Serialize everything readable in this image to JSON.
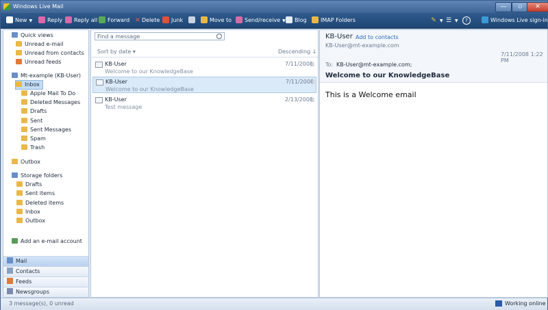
{
  "window": {
    "title": "Windows Live Mail",
    "min": "—",
    "max": "▫",
    "close": "✕"
  },
  "toolbar": {
    "new": "New",
    "reply": "Reply",
    "reply_all": "Reply all",
    "forward": "Forward",
    "delete": "Delete",
    "junk": "Junk",
    "move_to": "Move to",
    "send_receive": "Send/receive",
    "blog": "Blog",
    "imap_folders": "IMAP Folders",
    "signin": "Windows Live sign-in",
    "help": "?"
  },
  "nav": {
    "quick_views": "Quick views",
    "unread_email": "Unread e-mail",
    "unread_contacts": "Unread from contacts",
    "unread_feeds": "Unread feeds",
    "account": "Mt-example (KB-User)",
    "inbox": "Inbox",
    "folders": [
      "Apple Mail To Do",
      "Deleted Messages",
      "Drafts",
      "Sent",
      "Sent Messages",
      "Spam",
      "Trash"
    ],
    "outbox": "Outbox",
    "storage": "Storage folders",
    "storage_folders": [
      "Drafts",
      "Sent items",
      "Deleted items",
      "Inbox",
      "Outbox"
    ],
    "add_account": "Add an e-mail account"
  },
  "bottom_nav": [
    "Mail",
    "Contacts",
    "Feeds",
    "Newsgroups"
  ],
  "messages_pane": {
    "search_placeholder": "Find a message",
    "sort_by": "Sort by date",
    "order": "Descending",
    "messages": [
      {
        "from": "KB-User",
        "subject": "Welcome to our KnowledgeBase",
        "date": "7/11/2008"
      },
      {
        "from": "KB-User",
        "subject": "Welcome to our KnowledgeBase",
        "date": "7/11/2008"
      },
      {
        "from": "KB-User",
        "subject": "Test message",
        "date": "2/13/2008"
      }
    ]
  },
  "reading": {
    "sender": "KB-User",
    "add_contact": "Add to contacts",
    "email": "KB-User@mt-example.com",
    "datetime": "7/11/2008 1:22 PM",
    "to_label": "To:",
    "to_value": "KB-User@mt-example.com;",
    "subject": "Welcome to our KnowledgeBase",
    "body": "This is a Welcome email"
  },
  "status": {
    "count": "3 message(s), 0 unread",
    "online": "Working online"
  }
}
